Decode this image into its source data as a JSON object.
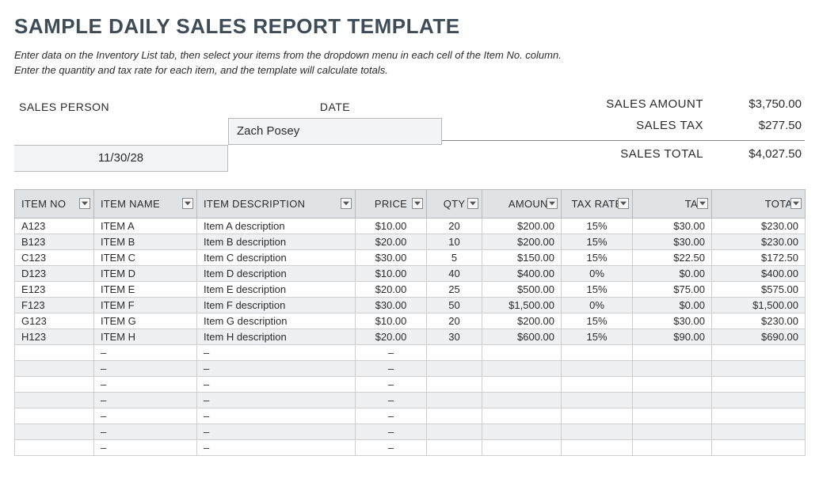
{
  "title": "SAMPLE DAILY SALES REPORT TEMPLATE",
  "instructions_line1": "Enter data on the Inventory List tab, then select your items from the dropdown menu in each cell of the Item No. column.",
  "instructions_line2": "Enter the quantity and tax rate for each item, and the template will calculate totals.",
  "labels": {
    "sales_person": "SALES PERSON",
    "date": "DATE",
    "sales_amount": "SALES AMOUNT",
    "sales_tax": "SALES TAX",
    "sales_total": "SALES TOTAL"
  },
  "sales_person": "Zach Posey",
  "date": "11/30/28",
  "summary": {
    "sales_amount": "$3,750.00",
    "sales_tax": "$277.50",
    "sales_total": "$4,027.50"
  },
  "columns": {
    "item_no": "ITEM NO",
    "item_name": "ITEM NAME",
    "item_desc": "ITEM DESCRIPTION",
    "price": "PRICE",
    "qty": "QTY",
    "amount": "AMOUNT",
    "tax_rate": "TAX RATE",
    "tax": "TAX",
    "total": "TOTAL"
  },
  "rows": [
    {
      "no": "A123",
      "name": "ITEM A",
      "desc": "Item A description",
      "price": "$10.00",
      "qty": "20",
      "amount": "$200.00",
      "rate": "15%",
      "tax": "$30.00",
      "total": "$230.00"
    },
    {
      "no": "B123",
      "name": "ITEM B",
      "desc": "Item B description",
      "price": "$20.00",
      "qty": "10",
      "amount": "$200.00",
      "rate": "15%",
      "tax": "$30.00",
      "total": "$230.00"
    },
    {
      "no": "C123",
      "name": "ITEM C",
      "desc": "Item C description",
      "price": "$30.00",
      "qty": "5",
      "amount": "$150.00",
      "rate": "15%",
      "tax": "$22.50",
      "total": "$172.50"
    },
    {
      "no": "D123",
      "name": "ITEM D",
      "desc": "Item D description",
      "price": "$10.00",
      "qty": "40",
      "amount": "$400.00",
      "rate": "0%",
      "tax": "$0.00",
      "total": "$400.00"
    },
    {
      "no": "E123",
      "name": "ITEM E",
      "desc": "Item E description",
      "price": "$20.00",
      "qty": "25",
      "amount": "$500.00",
      "rate": "15%",
      "tax": "$75.00",
      "total": "$575.00"
    },
    {
      "no": "F123",
      "name": "ITEM F",
      "desc": "Item F description",
      "price": "$30.00",
      "qty": "50",
      "amount": "$1,500.00",
      "rate": "0%",
      "tax": "$0.00",
      "total": "$1,500.00"
    },
    {
      "no": "G123",
      "name": "ITEM G",
      "desc": "Item G description",
      "price": "$10.00",
      "qty": "20",
      "amount": "$200.00",
      "rate": "15%",
      "tax": "$30.00",
      "total": "$230.00"
    },
    {
      "no": "H123",
      "name": "ITEM H",
      "desc": "Item H description",
      "price": "$20.00",
      "qty": "30",
      "amount": "$600.00",
      "rate": "15%",
      "tax": "$90.00",
      "total": "$690.00"
    },
    {
      "no": "",
      "name": "–",
      "desc": "–",
      "price": "–",
      "qty": "",
      "amount": "",
      "rate": "",
      "tax": "",
      "total": ""
    },
    {
      "no": "",
      "name": "–",
      "desc": "–",
      "price": "–",
      "qty": "",
      "amount": "",
      "rate": "",
      "tax": "",
      "total": ""
    },
    {
      "no": "",
      "name": "–",
      "desc": "–",
      "price": "–",
      "qty": "",
      "amount": "",
      "rate": "",
      "tax": "",
      "total": ""
    },
    {
      "no": "",
      "name": "–",
      "desc": "–",
      "price": "–",
      "qty": "",
      "amount": "",
      "rate": "",
      "tax": "",
      "total": ""
    },
    {
      "no": "",
      "name": "–",
      "desc": "–",
      "price": "–",
      "qty": "",
      "amount": "",
      "rate": "",
      "tax": "",
      "total": ""
    },
    {
      "no": "",
      "name": "–",
      "desc": "–",
      "price": "–",
      "qty": "",
      "amount": "",
      "rate": "",
      "tax": "",
      "total": ""
    },
    {
      "no": "",
      "name": "–",
      "desc": "–",
      "price": "–",
      "qty": "",
      "amount": "",
      "rate": "",
      "tax": "",
      "total": ""
    }
  ]
}
